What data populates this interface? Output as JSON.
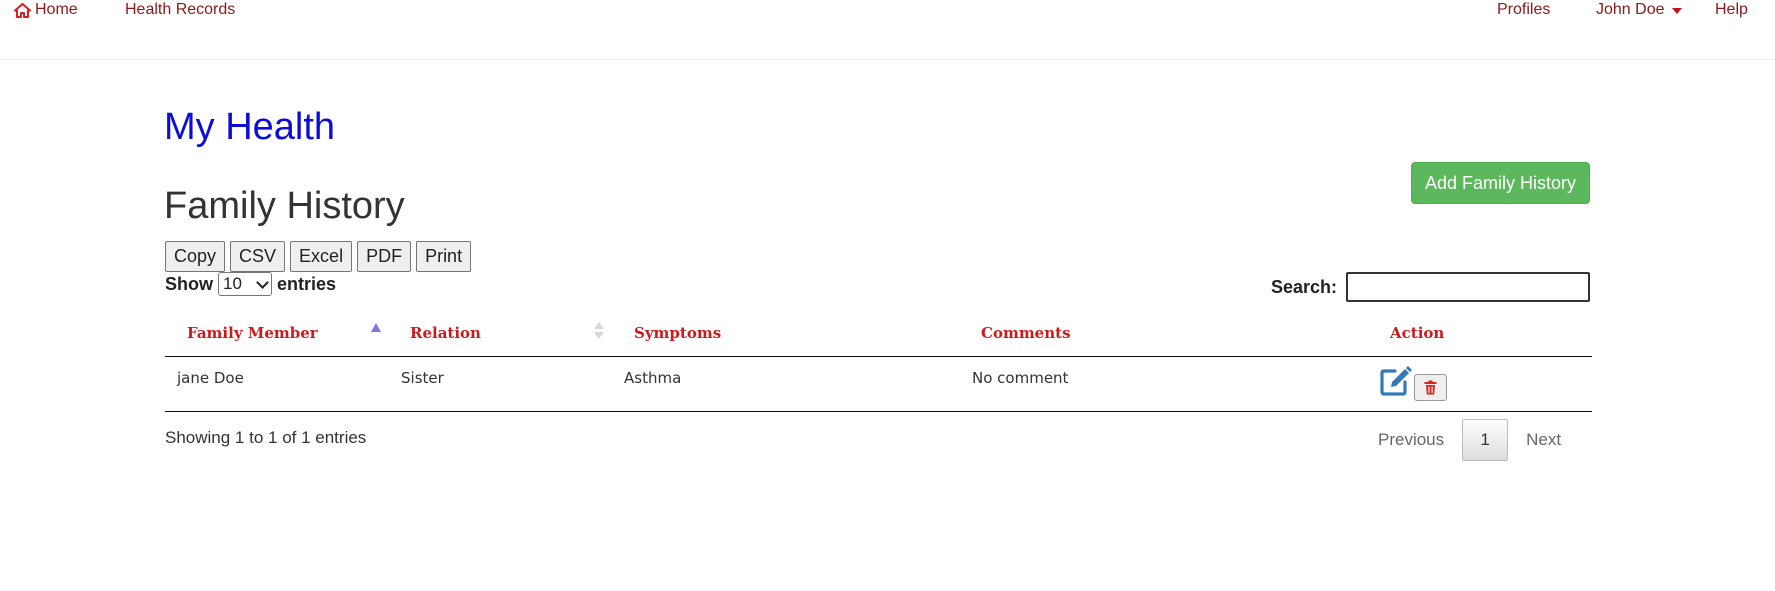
{
  "nav": {
    "home": "Home",
    "health_records": "Health Records",
    "profiles": "Profiles",
    "user": "John Doe",
    "help": "Help"
  },
  "app_title": "My Health",
  "section_title": "Family History",
  "add_button": "Add Family History",
  "export_buttons": [
    "Copy",
    "CSV",
    "Excel",
    "PDF",
    "Print"
  ],
  "length": {
    "show": "Show",
    "value": "10",
    "entries": "entries"
  },
  "search": {
    "label": "Search:",
    "value": ""
  },
  "table": {
    "headers": [
      "Family Member",
      "Relation",
      "Symptoms",
      "Comments",
      "Action"
    ],
    "rows": [
      [
        "jane Doe",
        "Sister",
        "Asthma",
        "No comment"
      ]
    ]
  },
  "info": "Showing 1 to 1 of 1 entries",
  "pagination": {
    "previous": "Previous",
    "current": "1",
    "next": "Next"
  },
  "colors": {
    "nav_text": "#8b1a1a",
    "title_blue": "#0c0cd8",
    "header_red": "#cc1b1b",
    "add_green": "#5cb85c",
    "edit_blue": "#337ab7",
    "delete_red": "#d9231d"
  }
}
